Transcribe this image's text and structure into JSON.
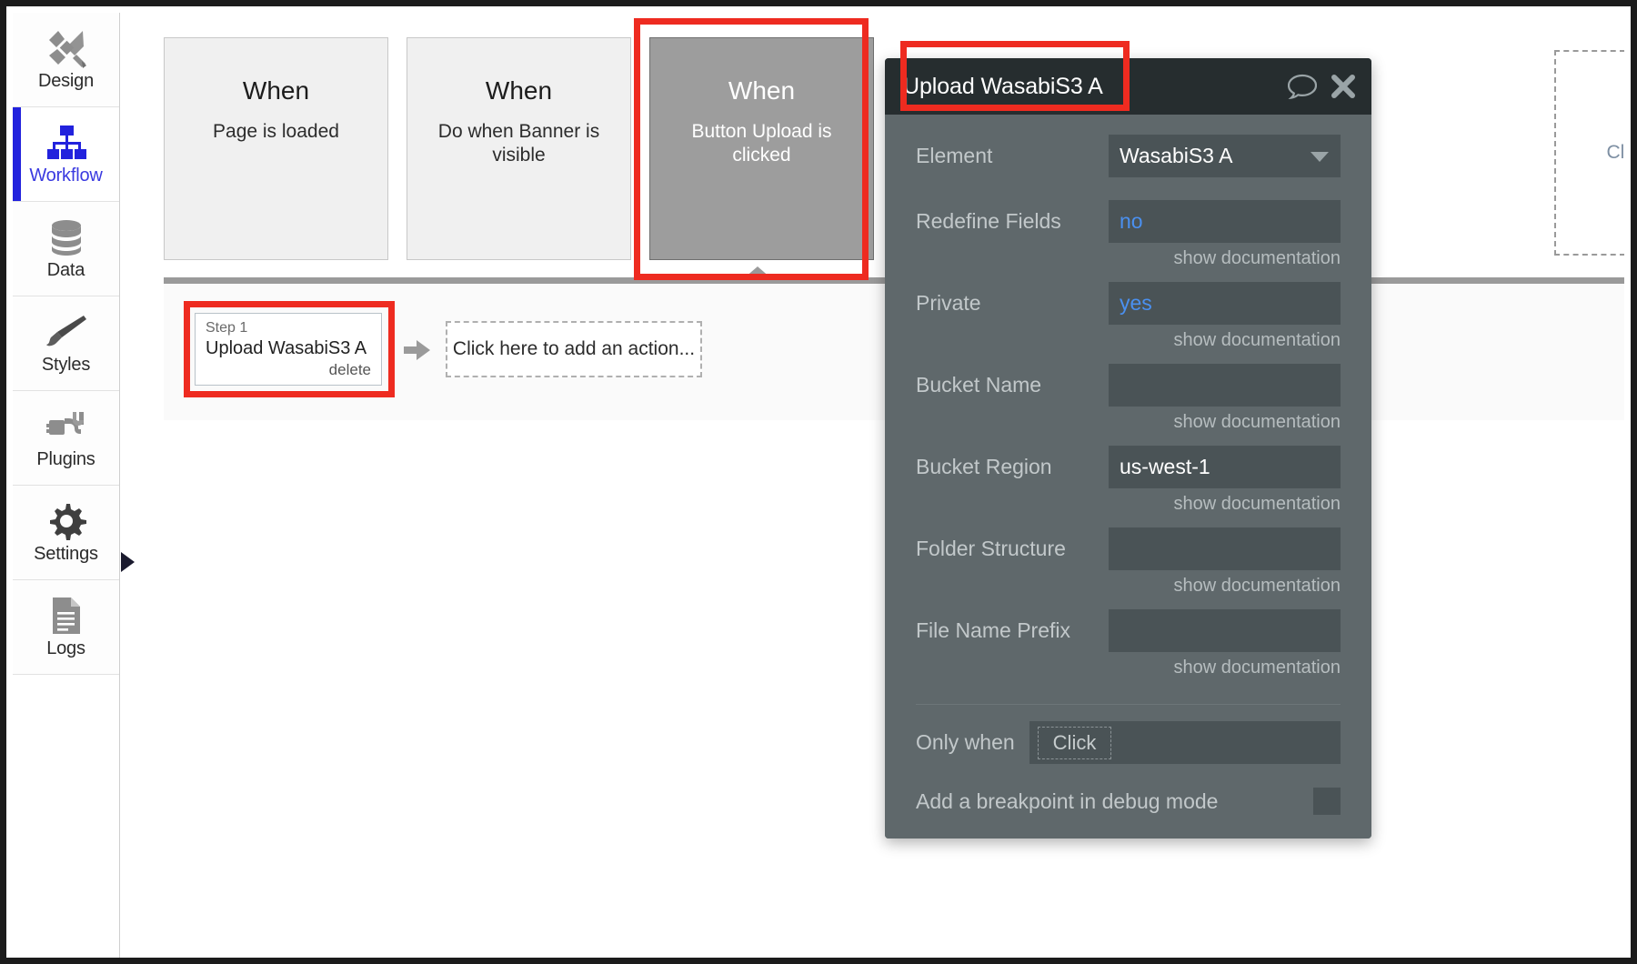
{
  "sidebar": {
    "items": [
      {
        "label": "Design",
        "icon": "design-icon",
        "active": false
      },
      {
        "label": "Workflow",
        "icon": "workflow-icon",
        "active": true
      },
      {
        "label": "Data",
        "icon": "database-icon",
        "active": false
      },
      {
        "label": "Styles",
        "icon": "brush-icon",
        "active": false
      },
      {
        "label": "Plugins",
        "icon": "plug-icon",
        "active": false
      },
      {
        "label": "Settings",
        "icon": "gear-icon",
        "active": false
      },
      {
        "label": "Logs",
        "icon": "document-icon",
        "active": false
      }
    ],
    "collapse_icon": "collapse-arrow-icon"
  },
  "canvas": {
    "events": [
      {
        "when": "When",
        "description": "Page is loaded",
        "selected": false
      },
      {
        "when": "When",
        "description": "Do when Banner is visible",
        "selected": false
      },
      {
        "when": "When",
        "description": "Button Upload is clicked",
        "selected": true
      }
    ],
    "edge_card_label": "Clic",
    "actions": {
      "step_number": "Step 1",
      "step_title": "Upload WasabiS3 A",
      "delete_label": "delete",
      "add_action_label": "Click here to add an action..."
    }
  },
  "modal": {
    "title": "Upload WasabiS3 A",
    "comment_icon": "speech-bubble-icon",
    "close_icon": "close-icon",
    "fields": [
      {
        "label": "Element",
        "value": "WasabiS3 A",
        "value_color": "white",
        "type": "select",
        "doc": ""
      },
      {
        "label": "Redefine Fields",
        "value": "no",
        "value_color": "blue",
        "type": "text",
        "doc": "show documentation"
      },
      {
        "label": "Private",
        "value": "yes",
        "value_color": "blue",
        "type": "text",
        "doc": "show documentation"
      },
      {
        "label": "Bucket Name",
        "value": "",
        "value_color": "white",
        "type": "text",
        "doc": "show documentation"
      },
      {
        "label": "Bucket Region",
        "value": "us-west-1",
        "value_color": "white",
        "type": "text",
        "doc": "show documentation"
      },
      {
        "label": "Folder Structure",
        "value": "",
        "value_color": "white",
        "type": "text",
        "doc": "show documentation"
      },
      {
        "label": "File Name Prefix",
        "value": "",
        "value_color": "white",
        "type": "text",
        "doc": "show documentation"
      }
    ],
    "only_when_label": "Only when",
    "only_when_value": "Click",
    "breakpoint_label": "Add a breakpoint in debug mode"
  },
  "colors": {
    "highlight": "#ee2b20",
    "accent_blue": "#2222dd",
    "modal_header": "#262d2f",
    "modal_body": "#5f686b",
    "input_bg": "#4a5356",
    "value_blue": "#4a90f0"
  }
}
